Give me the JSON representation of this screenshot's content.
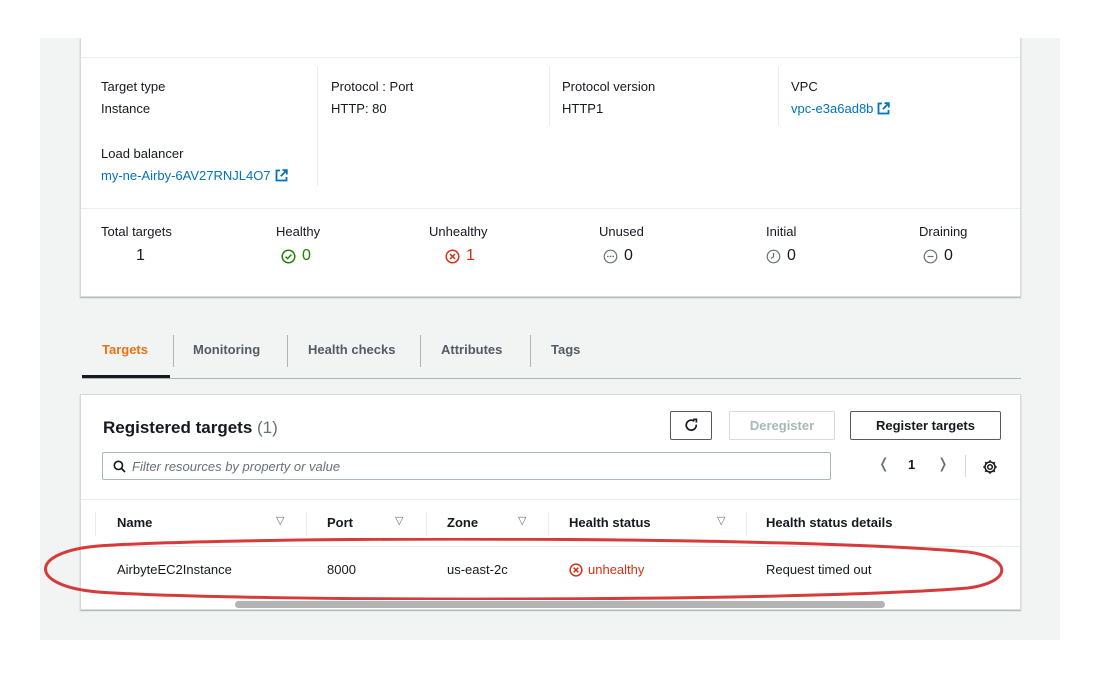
{
  "details": {
    "target_type": {
      "label": "Target type",
      "value": "Instance"
    },
    "protocol_port": {
      "label": "Protocol : Port",
      "value": "HTTP: 80"
    },
    "protocol_version": {
      "label": "Protocol version",
      "value": "HTTP1"
    },
    "vpc": {
      "label": "VPC",
      "value": "vpc-e3a6ad8b"
    },
    "load_balancer": {
      "label": "Load balancer",
      "value": "my-ne-Airby-6AV27RNJL4O7"
    }
  },
  "stats": {
    "total": {
      "label": "Total targets",
      "value": "1"
    },
    "healthy": {
      "label": "Healthy",
      "value": "0"
    },
    "unhealthy": {
      "label": "Unhealthy",
      "value": "1"
    },
    "unused": {
      "label": "Unused",
      "value": "0"
    },
    "initial": {
      "label": "Initial",
      "value": "0"
    },
    "draining": {
      "label": "Draining",
      "value": "0"
    }
  },
  "tabs": [
    {
      "label": "Targets",
      "active": true
    },
    {
      "label": "Monitoring"
    },
    {
      "label": "Health checks"
    },
    {
      "label": "Attributes"
    },
    {
      "label": "Tags"
    }
  ],
  "registered_targets": {
    "title": "Registered targets",
    "count": "(1)",
    "deregister_label": "Deregister",
    "register_label": "Register targets",
    "search_placeholder": "Filter resources by property or value",
    "page": "1",
    "columns": [
      "Name",
      "Port",
      "Zone",
      "Health status",
      "Health status details"
    ],
    "rows": [
      {
        "name": "AirbyteEC2Instance",
        "port": "8000",
        "zone": "us-east-2c",
        "health_status": "unhealthy",
        "health_status_details": "Request timed out"
      }
    ]
  },
  "colors": {
    "link": "#0073bb",
    "active_tab": "#ec7211",
    "healthy": "#1d8102",
    "unhealthy": "#d13212",
    "annotation": "#d63a3a"
  },
  "icons": {
    "external_link": "external-link-icon",
    "healthy": "check-circle-icon",
    "unhealthy": "x-circle-icon",
    "unused": "dots-circle-icon",
    "initial": "clock-icon",
    "draining": "minus-circle-icon",
    "refresh": "refresh-icon",
    "search": "search-icon",
    "settings": "gear-icon"
  }
}
